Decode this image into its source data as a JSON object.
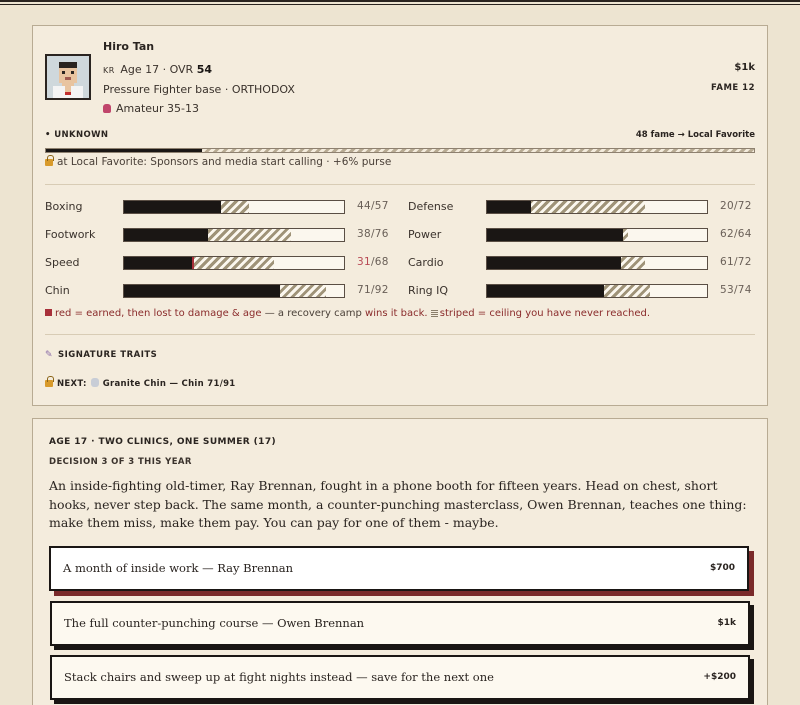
{
  "fighter": {
    "name": "Hiro Tan",
    "country_code": "KR",
    "age_ovr": "Age 17 · OVR",
    "ovr": "54",
    "style": "Pressure Fighter base · ORTHODOX",
    "record": "Amateur 35-13",
    "money": "$1k",
    "fame": "FAME 12"
  },
  "fame_track": {
    "status": "• UNKNOWN",
    "progress_text": "48 fame → Local Favorite",
    "progress": 0.22,
    "unlock_text": "at Local Favorite: Sponsors and media start calling · +6% purse"
  },
  "stats": [
    {
      "label": "Boxing",
      "current": 44,
      "ceiling": 57,
      "potential": 57,
      "lost": 0,
      "display": "44/57"
    },
    {
      "label": "Footwork",
      "current": 38,
      "ceiling": 76,
      "lost": 0,
      "display": "38/76"
    },
    {
      "label": "Speed",
      "current": 31,
      "ceiling": 68,
      "lost": 1,
      "display_cur": "31",
      "display_max": "/68"
    },
    {
      "label": "Chin",
      "current": 71,
      "ceiling": 92,
      "lost": 0,
      "display": "71/92"
    },
    {
      "label": "Defense",
      "current": 20,
      "ceiling": 72,
      "lost": 0,
      "display": "20/72"
    },
    {
      "label": "Power",
      "current": 62,
      "ceiling": 64,
      "lost": 0,
      "display": "62/64"
    },
    {
      "label": "Cardio",
      "current": 61,
      "ceiling": 72,
      "lost": 0,
      "display": "61/72"
    },
    {
      "label": "Ring IQ",
      "current": 53,
      "ceiling": 74,
      "lost": 0,
      "display": "53/74"
    }
  ],
  "legend": {
    "red_text": "red = earned, then lost to damage & age",
    "middle": " — a recovery camp ",
    "wins": "wins it back.",
    "striped": "striped = ceiling you have never reached."
  },
  "traits": {
    "title": "SIGNATURE TRAITS",
    "next_label": "NEXT:",
    "next_value": "Granite Chin — Chin 71/91"
  },
  "event": {
    "title": "AGE 17 · TWO CLINICS, ONE SUMMER (17)",
    "subtitle": "DECISION 3 OF 3 THIS YEAR",
    "body": "An inside-fighting old-timer, Ray Brennan, fought in a phone booth for fifteen years. Head on chest, short hooks, never step back. The same month, a counter-punching masterclass, Owen Brennan, teaches one thing: make them miss, make them pay. You can pay for one of them - maybe.",
    "choices": [
      {
        "text": "A month of inside work — Ray Brennan",
        "cost": "$700"
      },
      {
        "text": "The full counter-punching course — Owen Brennan",
        "cost": "$1k"
      },
      {
        "text": "Stack chairs and sweep up at fight nights instead — save for the next one",
        "cost": "+$200"
      }
    ]
  }
}
